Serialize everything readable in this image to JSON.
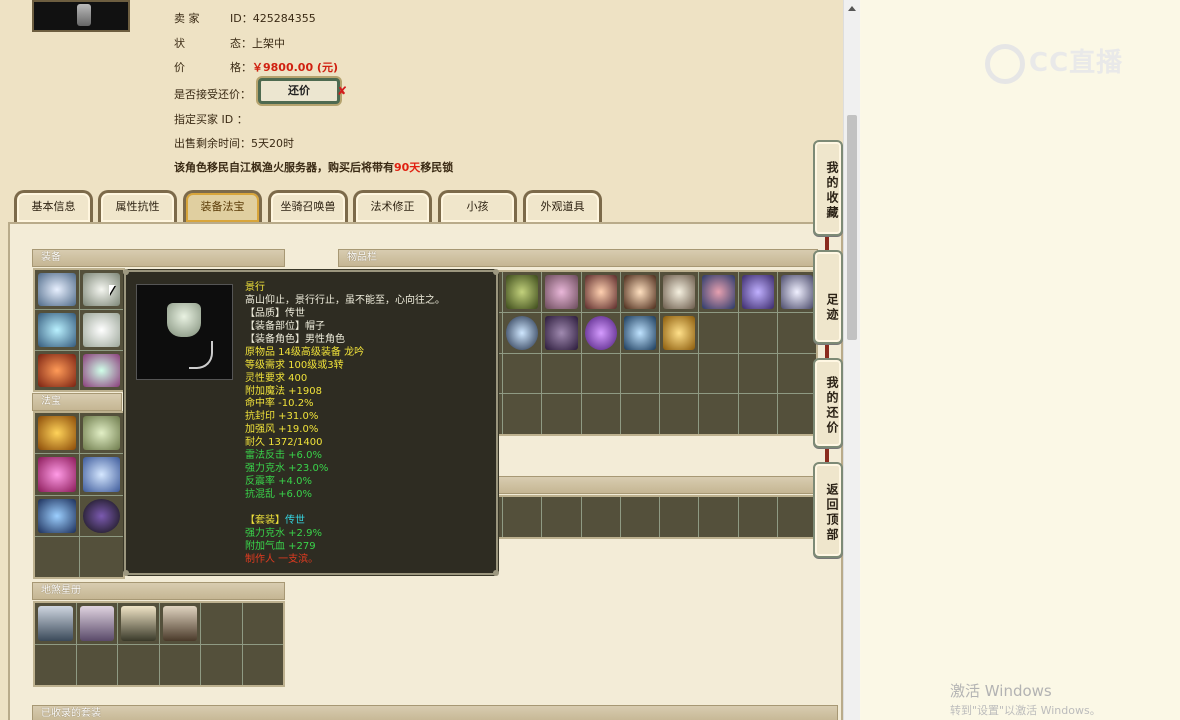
{
  "seller": {
    "label": "卖 家",
    "id_label": "ID：",
    "id_value": "425284355"
  },
  "status": {
    "label": "状",
    "label2": "态：",
    "value": "上架中"
  },
  "price": {
    "label": "价",
    "label2": "格：",
    "value": "￥9800.00 (元)"
  },
  "counter_offer": {
    "label": "是否接受还价：",
    "button": "还价",
    "x_mark": "✘"
  },
  "buyer": {
    "label": "指定买家 ID ："
  },
  "time_left": {
    "label": "出售剩余时间：",
    "value": "5天20时"
  },
  "migration": {
    "text_before": "该角色移民自江枫渔火服务器，购买后将带有",
    "days": "90天",
    "text_after": "移民锁"
  },
  "tabs": [
    {
      "label": "基本信息"
    },
    {
      "label": "属性抗性"
    },
    {
      "label": "装备法宝"
    },
    {
      "label": "坐骑召唤兽"
    },
    {
      "label": "法术修正"
    },
    {
      "label": "小孩"
    },
    {
      "label": "外观道具"
    }
  ],
  "sections": {
    "equipment": "装备",
    "inventory": "物品栏",
    "fabao": "法宝",
    "disha": "地煞星册",
    "collected_sets": "已收录的套装"
  },
  "tooltip": {
    "lines": [
      {
        "text": "景行",
        "color": "yellow"
      },
      {
        "text": "高山仰止，景行行止，虽不能至，心向往之。",
        "color": "white"
      },
      {
        "text": "【品质】传世",
        "color": "white"
      },
      {
        "text": "【装备部位】帽子",
        "color": "white"
      },
      {
        "text": "【装备角色】男性角色",
        "color": "white"
      },
      {
        "text": "原物品 14级高级装备 龙吟",
        "color": "yellow"
      },
      {
        "text": "等级需求 100级或3转",
        "color": "yellow"
      },
      {
        "text": "灵性要求 400",
        "color": "yellow"
      },
      {
        "text": "附加魔法 +1908",
        "color": "yellow"
      },
      {
        "text": "命中率 -10.2%",
        "color": "yellow"
      },
      {
        "text": "抗封印 +31.0%",
        "color": "yellow"
      },
      {
        "text": "加强风 +19.0%",
        "color": "yellow"
      },
      {
        "text": "耐久 1372/1400",
        "color": "yellow"
      },
      {
        "text": "雷法反击 +6.0%",
        "color": "green"
      },
      {
        "text": "强力克水 +23.0%",
        "color": "green"
      },
      {
        "text": "反震率 +4.0%",
        "color": "green"
      },
      {
        "text": "抗混乱 +6.0%",
        "color": "green"
      },
      {
        "text": "",
        "color": "white"
      },
      {
        "text": "【套装】传世",
        "color": "cyan_mixed"
      },
      {
        "text": "强力克水 +2.9%",
        "color": "green"
      },
      {
        "text": "附加气血 +279",
        "color": "green"
      },
      {
        "text": "制作人 一支滨。",
        "color": "red"
      }
    ],
    "set_prefix": "【套装】",
    "set_name": "传世"
  },
  "side_buttons": [
    {
      "label": "我的收藏"
    },
    {
      "label": "足迹"
    },
    {
      "label": "我的还价"
    },
    {
      "label": "返回顶部"
    }
  ],
  "watermark": {
    "brand": "CC直播"
  },
  "windows_activation": {
    "title": "激活 Windows",
    "subtitle": "转到\"设置\"以激活 Windows。"
  },
  "colors": {
    "price_red": "#d02010",
    "tooltip_bg": "#2e2c22",
    "tooltip_yellow": "#f0e23a",
    "tooltip_green": "#39d34a",
    "tab_active_border": "#d8a53a"
  }
}
